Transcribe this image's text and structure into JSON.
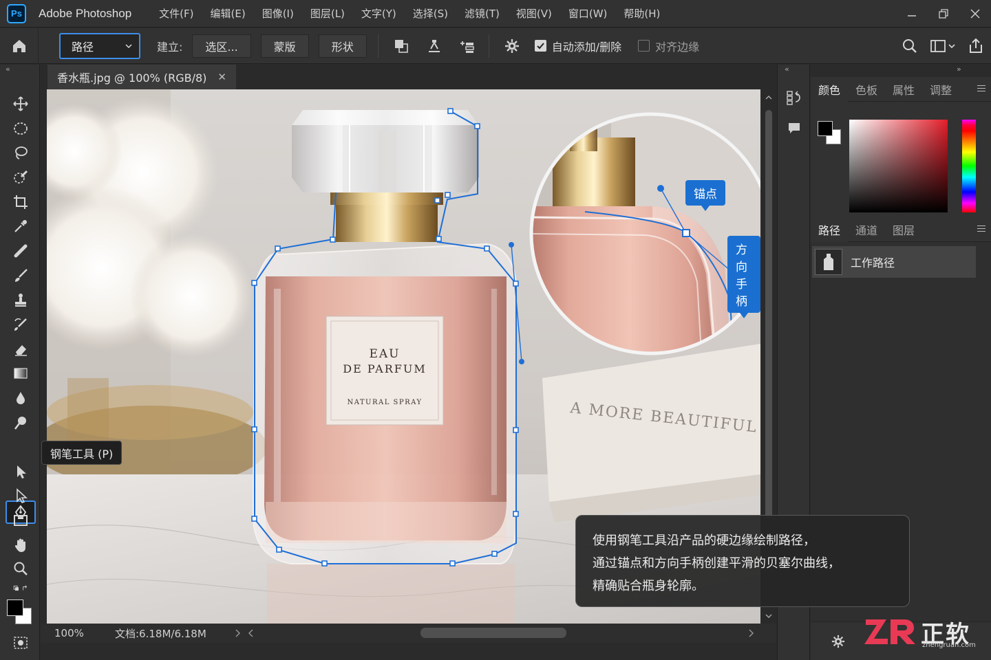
{
  "app": {
    "name": "Adobe Photoshop",
    "logo": "Ps"
  },
  "menu": [
    "文件(F)",
    "编辑(E)",
    "图像(I)",
    "图层(L)",
    "文字(Y)",
    "选择(S)",
    "滤镜(T)",
    "视图(V)",
    "窗口(W)",
    "帮助(H)"
  ],
  "options": {
    "mode": "路径",
    "make_label": "建立:",
    "selection_btn": "选区...",
    "mask_btn": "蒙版",
    "shape_btn": "形状",
    "auto_add_label": "自动添加/删除",
    "auto_add_checked": true,
    "align_edges_label": "对齐边缘",
    "align_edges_checked": false
  },
  "document": {
    "tab_title": "香水瓶.jpg @ 100% (RGB/8)",
    "zoom": "100%",
    "doc_info": "文档:6.18M/6.18M"
  },
  "tooltip": "钢笔工具 (P)",
  "label_text": {
    "line1": "EAU",
    "line2": "DE PARFUM",
    "line3": "NATURAL SPRAY"
  },
  "book_text": "A MORE BEAUTIFUL LIFE",
  "callouts": {
    "anchor": "锚点",
    "handle": "方向手柄"
  },
  "caption": [
    "使用钢笔工具沿产品的硬边缘绘制路径，",
    "通过锚点和方向手柄创建平滑的贝塞尔曲线，",
    "精确贴合瓶身轮廓。"
  ],
  "color_panel": {
    "tabs": [
      "颜色",
      "色板",
      "属性",
      "调整"
    ],
    "active_tab": "颜色"
  },
  "paths_panel": {
    "tabs": [
      "路径",
      "通道",
      "图层"
    ],
    "active_tab": "路径",
    "items": [
      "工作路径"
    ]
  },
  "watermark": {
    "zh": "正软",
    "en": "zhengruan.com"
  },
  "colors": {
    "accent": "#3d8eea",
    "path_blue": "#1a6fd1",
    "ps_blue": "#31a8ff"
  }
}
